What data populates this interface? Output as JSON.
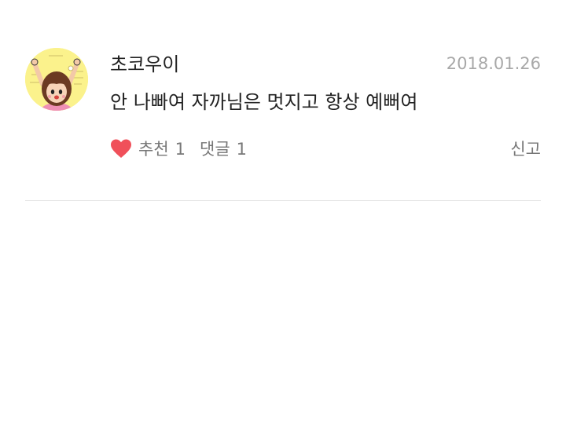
{
  "comment": {
    "author": "초코우이",
    "date": "2018.01.26",
    "text": "안 나빠여 자까님은 멋지고 항상 예뻐여",
    "like_label": "추천",
    "like_count": "1",
    "reply_label": "댓글",
    "reply_count": "1",
    "report_label": "신고",
    "like_icon": "heart-icon",
    "like_color": "#f0505a",
    "avatar_bg": "#fbf28c"
  }
}
